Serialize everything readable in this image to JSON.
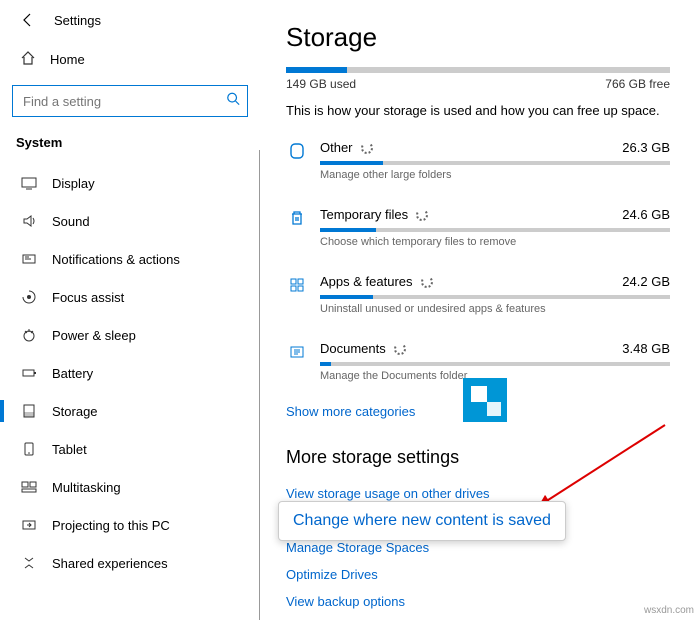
{
  "header": {
    "title": "Settings"
  },
  "sidebar": {
    "home_label": "Home",
    "search_placeholder": "Find a setting",
    "section_label": "System",
    "items": [
      {
        "label": "Display"
      },
      {
        "label": "Sound"
      },
      {
        "label": "Notifications & actions"
      },
      {
        "label": "Focus assist"
      },
      {
        "label": "Power & sleep"
      },
      {
        "label": "Battery"
      },
      {
        "label": "Storage"
      },
      {
        "label": "Tablet"
      },
      {
        "label": "Multitasking"
      },
      {
        "label": "Projecting to this PC"
      },
      {
        "label": "Shared experiences"
      }
    ],
    "selected_index": 6
  },
  "main": {
    "title": "Storage",
    "used_label": "149 GB used",
    "free_label": "766 GB free",
    "used_pct": 16,
    "intro": "This is how your storage is used and how you can free up space.",
    "categories": [
      {
        "name": "Other",
        "size": "26.3 GB",
        "bar_pct": 18,
        "desc": "Manage other large folders"
      },
      {
        "name": "Temporary files",
        "size": "24.6 GB",
        "bar_pct": 16,
        "desc": "Choose which temporary files to remove"
      },
      {
        "name": "Apps & features",
        "size": "24.2 GB",
        "bar_pct": 15,
        "desc": "Uninstall unused or undesired apps & features"
      },
      {
        "name": "Documents",
        "size": "3.48 GB",
        "bar_pct": 3,
        "desc": "Manage the Documents folder"
      }
    ],
    "show_more": "Show more categories",
    "more_header": "More storage settings",
    "more_links": [
      "View storage usage on other drives",
      "Change where new content is saved",
      "Manage Storage Spaces",
      "Optimize Drives",
      "View backup options"
    ]
  },
  "callout": {
    "text": "Change where new content is saved"
  },
  "watermark": "wsxdn.com"
}
